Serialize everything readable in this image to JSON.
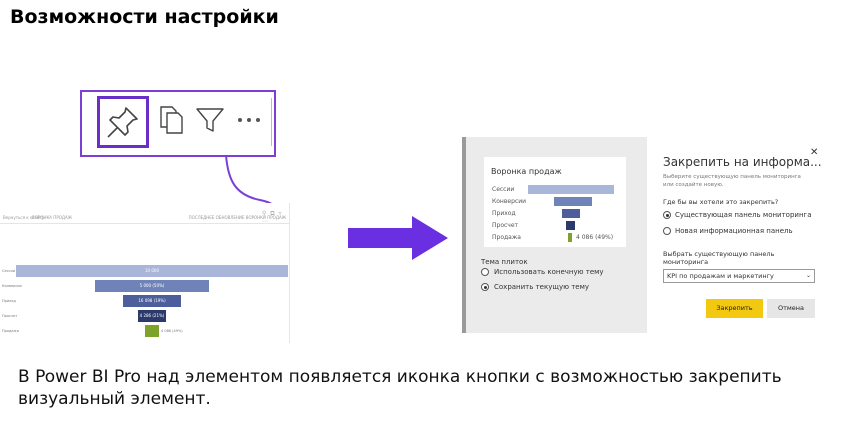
{
  "slide": {
    "title": "Возможности настройки",
    "caption": "В Power BI Pro над элементом появляется иконка кнопки с возможностью закрепить визуальный элемент."
  },
  "toolbar": {
    "icons": [
      "pin-icon",
      "copy-icon",
      "filter-icon",
      "more-options-icon"
    ],
    "accent_color": "#7b3fd6"
  },
  "mini_visual": {
    "crumbs": [
      "Вернуться к отчёту",
      "ВОРОНКА ПРОДАЖ"
    ],
    "header_right": "ПОСЛЕДНЕЕ ОБНОВЛЕНИЕ ВОРОНКИ ПРОДАЖ",
    "labels": [
      "Сессии",
      "Конверсии",
      "Приход",
      "Просчет",
      "Продажа"
    ],
    "values": [
      "10 000",
      "5 000 (50%)",
      "16 098 (19%)",
      "4 286 (21%)",
      "4 086 (49%)"
    ]
  },
  "pin_shot": {
    "card": {
      "title": "Воронка продаж",
      "rows": [
        "Сессии",
        "Конверсии",
        "Приход",
        "Просчет",
        "Продажа"
      ],
      "sale_value": "4 086 (49%)"
    },
    "theme": {
      "title": "Тема плиток",
      "options": [
        "Использовать конечную тему",
        "Сохранить текущую тему"
      ],
      "selected": 1
    },
    "dialog": {
      "title": "Закрепить на информа...",
      "close": "✕",
      "subtitle": "Выберите существующую панель мониторинга или создайте новую.",
      "question": "Где бы вы хотели это закрепить?",
      "options": [
        "Существующая панель мониторинга",
        "Новая информационная панель"
      ],
      "selected": 0,
      "select_label": "Выбрать существующую панель мониторинга",
      "select_value": "KPI по продажам и маркетингу",
      "pin_button": "Закрепить",
      "cancel_button": "Отмена"
    }
  },
  "colors": {
    "arrow": "#6a2fe0",
    "funnel_light": "#a9b5d9",
    "funnel_mid": "#7083b8",
    "funnel_dark": "#4c5f9c",
    "funnel_darkest": "#2c3a6b",
    "funnel_green": "#7ea32b",
    "pin_button": "#f2c811"
  }
}
